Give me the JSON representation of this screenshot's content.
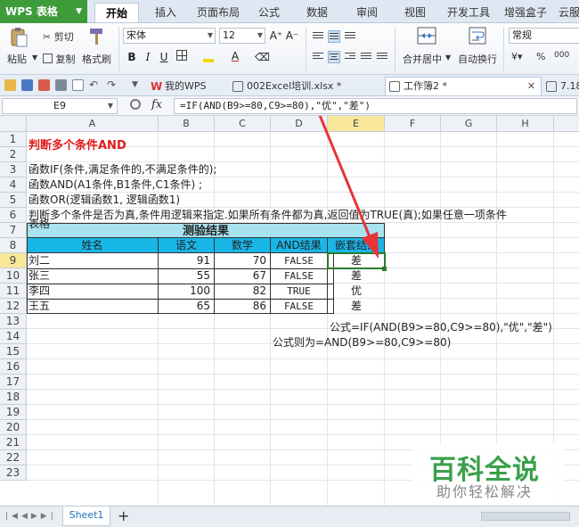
{
  "app": {
    "logo": "WPS 表格"
  },
  "menu_tabs": [
    "开始",
    "插入",
    "页面布局",
    "公式",
    "数据",
    "审阅",
    "视图",
    "开发工具",
    "增强盒子",
    "云服"
  ],
  "ribbon": {
    "paste": "粘贴",
    "cut": "剪切",
    "copy": "复制",
    "format_painter": "格式刷",
    "font_name": "宋体",
    "font_size": "12",
    "grow_font": "A⁺",
    "shrink_font": "A⁻",
    "bold": "B",
    "italic": "I",
    "underline": "U",
    "merge_center": "合并居中",
    "wrap_text": "自动换行",
    "number_format": "常规",
    "percent": "%",
    "comma": "000"
  },
  "doc_tabs": [
    {
      "label": "我的WPS"
    },
    {
      "label": "002Excel培训.xlsx *"
    },
    {
      "label": "工作簿2 *"
    },
    {
      "label": "7.18"
    }
  ],
  "formula_bar": {
    "name_box": "E9",
    "fx": "fx",
    "formula": "=IF(AND(B9>=80,C9>=80),\"优\",\"差\")"
  },
  "columns": [
    "A",
    "B",
    "C",
    "D",
    "E",
    "F",
    "G",
    "H"
  ],
  "rows": [
    "1",
    "2",
    "3",
    "4",
    "5",
    "6",
    "7",
    "8",
    "9",
    "10",
    "11",
    "12",
    "13",
    "14",
    "15",
    "16",
    "17",
    "18",
    "19",
    "20",
    "21",
    "22",
    "23"
  ],
  "sheet": {
    "r1": "判断多个条件AND",
    "r2": "函数IF(条件,满足条件的,不满足条件的);",
    "r3": "函数AND(A1条件,B1条件,C1条件) ;",
    "r4": "函数OR(逻辑函数1, 逻辑函数1)",
    "r5": "判断多个条件是否为真,条件用逻辑来指定.如果所有条件都为真,返回值为TRUE(真);如果任意一项条件",
    "r6": "表格",
    "table_title": "测验结果",
    "headers": [
      "姓名",
      "语文",
      "数学",
      "AND结果",
      "嵌套结果"
    ],
    "data": [
      {
        "name": "刘二",
        "chinese": "91",
        "math": "70",
        "and": "FALSE",
        "nested": "差"
      },
      {
        "name": "张三",
        "chinese": "55",
        "math": "67",
        "and": "FALSE",
        "nested": "差"
      },
      {
        "name": "李四",
        "chinese": "100",
        "math": "82",
        "and": "TRUE",
        "nested": "优"
      },
      {
        "name": "王五",
        "chinese": "65",
        "math": "86",
        "and": "FALSE",
        "nested": "差"
      }
    ],
    "note1": "公式=IF(AND(B9>=80,C9>=80),\"优\",\"差\")",
    "note2": "公式则为=AND(B9>=80,C9>=80)"
  },
  "sheet_tabs": [
    "Sheet1"
  ],
  "add_sheet": "+",
  "watermark": {
    "line1": "百科全说",
    "line2": "助你轻松解决"
  },
  "colors": {
    "title_red": "#e01b1b",
    "table_title_bg": "#a9e3ef",
    "header_bg": "#19b6e8",
    "arrow": "#e8333a",
    "wps_green": "#3d9b3a"
  }
}
